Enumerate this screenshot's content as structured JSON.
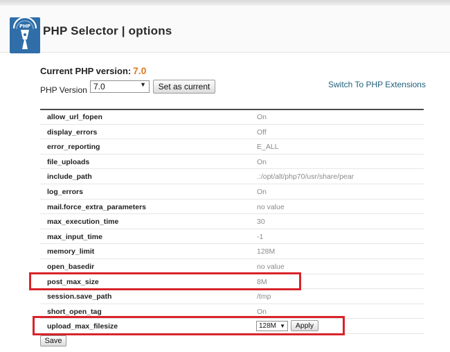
{
  "header": {
    "title": "PHP Selector | options"
  },
  "current": {
    "label": "Current PHP version:",
    "value": "7.0"
  },
  "version": {
    "label": "PHP Version",
    "selected": "7.0",
    "set_button": "Set as current",
    "switch_link": "Switch To PHP Extensions"
  },
  "options": [
    {
      "key": "allow_url_fopen",
      "value": "On"
    },
    {
      "key": "display_errors",
      "value": "Off"
    },
    {
      "key": "error_reporting",
      "value": "E_ALL"
    },
    {
      "key": "file_uploads",
      "value": "On"
    },
    {
      "key": "include_path",
      "value": ".:/opt/alt/php70/usr/share/pear"
    },
    {
      "key": "log_errors",
      "value": "On"
    },
    {
      "key": "mail.force_extra_parameters",
      "value": "no value"
    },
    {
      "key": "max_execution_time",
      "value": "30"
    },
    {
      "key": "max_input_time",
      "value": "-1"
    },
    {
      "key": "memory_limit",
      "value": "128M"
    },
    {
      "key": "open_basedir",
      "value": "no value"
    },
    {
      "key": "post_max_size",
      "value": "8M"
    },
    {
      "key": "session.save_path",
      "value": "/tmp"
    },
    {
      "key": "short_open_tag",
      "value": "On"
    },
    {
      "key": "upload_max_filesize",
      "value": "128M",
      "apply": "Apply"
    }
  ],
  "footer": {
    "save": "Save"
  },
  "colors": {
    "version_accent": "#e07a1f",
    "highlight": "#d8232a",
    "link": "#1f5f7a"
  }
}
